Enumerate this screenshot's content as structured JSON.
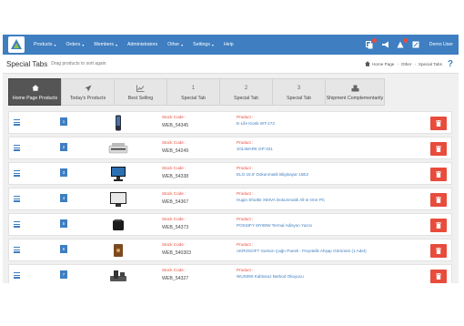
{
  "nav": {
    "items": [
      {
        "label": "Products",
        "caret": "▾"
      },
      {
        "label": "Orders",
        "caret": "▾"
      },
      {
        "label": "Members",
        "caret": "▾"
      },
      {
        "label": "Administrators",
        "caret": ""
      },
      {
        "label": "Other",
        "caret": "▾"
      },
      {
        "label": "Settings",
        "caret": "▾"
      },
      {
        "label": "Help",
        "caret": ""
      }
    ],
    "user": "Demo User",
    "accent": "#3e7ec1"
  },
  "header": {
    "title": "Special Tabs",
    "subtitle": "Drag products to sort again",
    "breadcrumb": [
      "Home Page",
      "Other",
      "Special Tabs"
    ],
    "help": "?"
  },
  "tabs": [
    {
      "label": "Home Page Products",
      "icon": "home-icon",
      "glyph": ""
    },
    {
      "label": "Today's Products",
      "icon": "paper-plane-icon",
      "glyph": ""
    },
    {
      "label": "Best Selling",
      "icon": "line-chart-icon",
      "glyph": ""
    },
    {
      "label": "Special Tab",
      "icon": "number-icon",
      "glyph": "1"
    },
    {
      "label": "Special Tab",
      "icon": "number-icon",
      "glyph": "2"
    },
    {
      "label": "Special Tab",
      "icon": "number-icon",
      "glyph": "3"
    },
    {
      "label": "Shipment Complementarity",
      "icon": "cubes-icon",
      "glyph": ""
    }
  ],
  "rows_labels": {
    "stock": "Stock Code :",
    "product": "Product :"
  },
  "rows": [
    {
      "num": "1",
      "stock": "WEB_54345",
      "product": "E-Life Kiosk WT-172",
      "thumb": "phone"
    },
    {
      "num": "2",
      "stock": "WEB_54249",
      "product": "JOLIMARK DP-321",
      "thumb": "printer"
    },
    {
      "num": "3",
      "stock": "WEB_54338",
      "product": "ELO 15.6' Dokunmatik Bilgisayar 15E2",
      "thumb": "pos"
    },
    {
      "num": "4",
      "stock": "WEB_54367",
      "product": "Hugin Shuttle X50VA Dokunmatik All-in-One PC",
      "thumb": "monitor"
    },
    {
      "num": "5",
      "stock": "WEB_54373",
      "product": "POSSIFY MY80W Termal Adisyon Yazıcı",
      "thumb": "box"
    },
    {
      "num": "6",
      "stock": "WEB_540303",
      "product": "AKROSOFT Garson Çağrı Paneli - Peçetelik Ahşap Görünüm (1 Adet)",
      "thumb": "panel"
    },
    {
      "num": "7",
      "stock": "WEB_54327",
      "product": "WUS090 Kablosuz Barkod Okuyucu",
      "thumb": "scanner"
    }
  ],
  "colors": {
    "delete": "#e74c3c",
    "active_tab": "#555555"
  }
}
